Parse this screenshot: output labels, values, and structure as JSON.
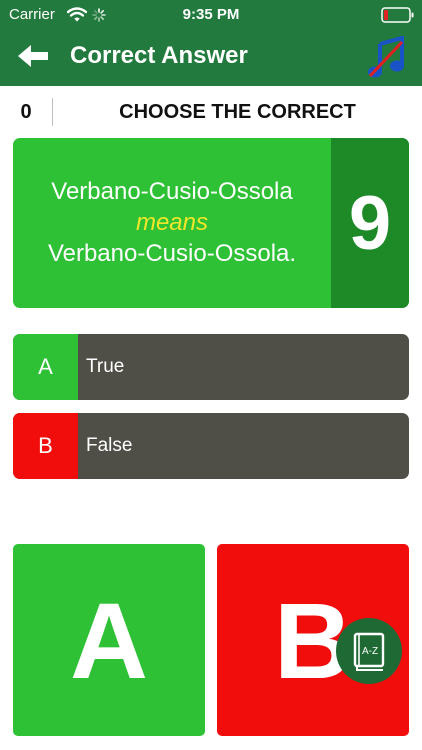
{
  "status_bar": {
    "carrier": "Carrier",
    "time": "9:35 PM",
    "icons": [
      "wifi-icon",
      "spinner-icon",
      "battery-icon"
    ]
  },
  "nav": {
    "title": "Correct Answer",
    "back_icon": "back-arrow-icon",
    "music_icon": "music-icon"
  },
  "question_header": {
    "score": "0",
    "instruction": "CHOOSE THE CORRECT"
  },
  "question": {
    "line1": "Verbano-Cusio-Ossola",
    "means": "means",
    "line2": "Verbano-Cusio-Ossola.",
    "timer": "9"
  },
  "options": [
    {
      "letter": "A",
      "label": "True"
    },
    {
      "letter": "B",
      "label": "False"
    }
  ],
  "big_buttons": {
    "a": "A",
    "b": "B"
  },
  "dictionary_button": {
    "icon": "dictionary-book-icon",
    "icon_text": "A-Z"
  },
  "colors": {
    "header_green": "#237a3e",
    "correct_green": "#2ec135",
    "timer_green": "#1d8a27",
    "wrong_red": "#f20d0d",
    "option_gray": "#4f4f47",
    "means_yellow": "#f0e62a"
  }
}
